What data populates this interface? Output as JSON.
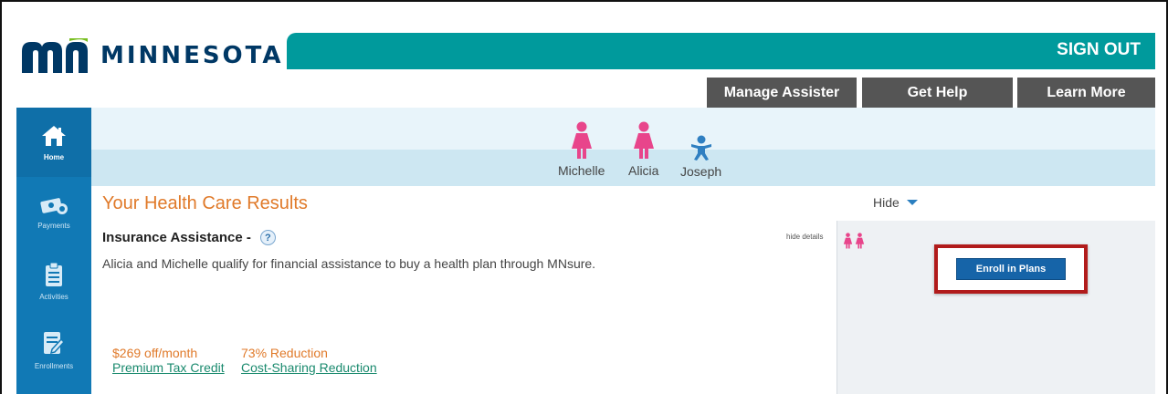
{
  "header": {
    "brand": "MINNESOTA",
    "sign_out": "SIGN OUT",
    "buttons": [
      "Manage Assister",
      "Get Help",
      "Learn More"
    ]
  },
  "sidebar": {
    "items": [
      {
        "label": "Home",
        "icon": "home-icon",
        "active": true
      },
      {
        "label": "Payments",
        "icon": "payments-icon",
        "active": false
      },
      {
        "label": "Activities",
        "icon": "activities-icon",
        "active": false
      },
      {
        "label": "Enrollments",
        "icon": "enrollments-icon",
        "active": false
      }
    ]
  },
  "household": {
    "members": [
      {
        "name": "Michelle",
        "icon": "female-person-icon",
        "color": "#e8458b"
      },
      {
        "name": "Alicia",
        "icon": "female-person-icon",
        "color": "#e8458b"
      },
      {
        "name": "Joseph",
        "icon": "child-person-icon",
        "color": "#2f7fc1"
      }
    ]
  },
  "results": {
    "title": "Your Health Care Results",
    "hide": "Hide",
    "insurance_title": "Insurance Assistance -",
    "help": "?",
    "hide_details": "hide details",
    "description": "Alicia and Michelle qualify for financial assistance to buy a health plan through MNsure.",
    "stats": [
      {
        "value": "$269 off/month",
        "label": "Premium Tax Credit"
      },
      {
        "value": "73% Reduction",
        "label": "Cost-Sharing Reduction"
      }
    ],
    "enroll_button": "Enroll in Plans"
  },
  "colors": {
    "teal": "#009a9c",
    "navy": "#003865",
    "sidebar_blue": "#1179b5",
    "orange": "#e07a2a",
    "highlight_red": "#b11b1b"
  }
}
